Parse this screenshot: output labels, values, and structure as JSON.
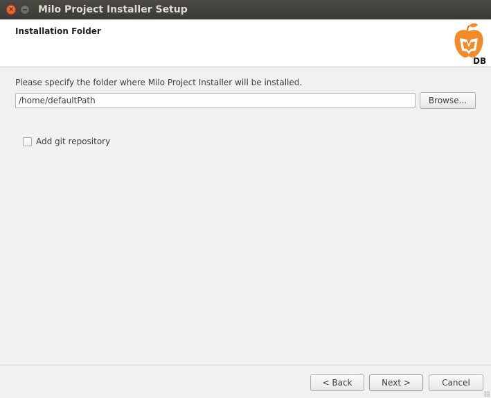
{
  "window": {
    "title": "Milo Project Installer Setup"
  },
  "header": {
    "title": "Installation Folder",
    "logo": {
      "icon": "apple-db-logo",
      "text": "DB",
      "colors": {
        "primary": "#f28c28",
        "dark": "#e06a10",
        "text": "#1a1a1a"
      }
    }
  },
  "main": {
    "prompt": "Please specify the folder where Milo Project Installer will be installed.",
    "path": {
      "value": "/home/defaultPath"
    },
    "browse_button": {
      "label": "Browse...",
      "mnemonic": "r"
    },
    "git_checkbox": {
      "label": "Add git repository",
      "checked": false
    }
  },
  "footer": {
    "back_button": {
      "label": "< Back",
      "mnemonic": "B"
    },
    "next_button": {
      "label": "Next >",
      "mnemonic": "N"
    },
    "cancel_button": {
      "label": "Cancel"
    }
  },
  "theme": {
    "titlebar": "#3c3b37",
    "close": "#e95420",
    "background": "#f2f1f0"
  }
}
